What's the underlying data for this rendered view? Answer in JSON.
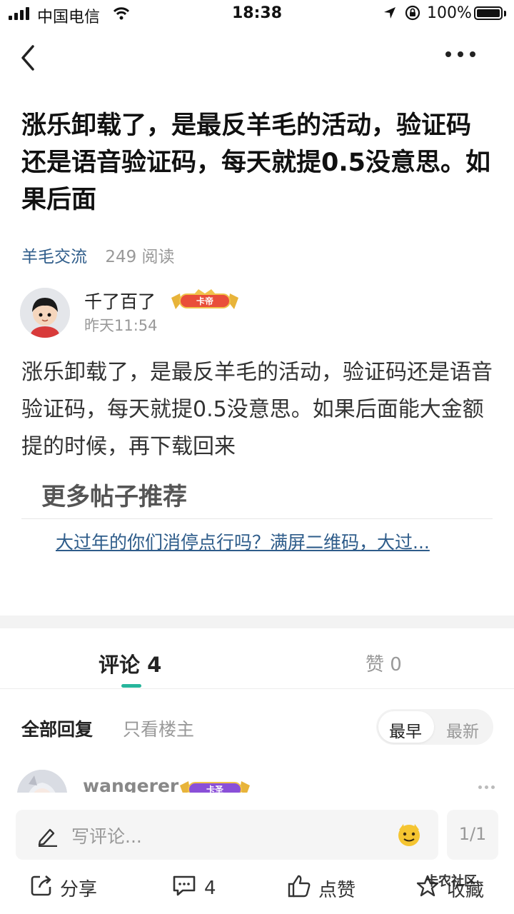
{
  "status_bar": {
    "carrier": "中国电信",
    "time": "18:38",
    "battery": "100%"
  },
  "post": {
    "title": "涨乐卸载了，是最反羊毛的活动，验证码还是语音验证码，每天就提0.5没意思。如果后面",
    "tag": "羊毛交流",
    "reads": "249 阅读",
    "author": "千了百了",
    "author_badge": "卡帝",
    "time": "昨天11:54",
    "body": "涨乐卸载了，是最反羊毛的活动，验证码还是语音验证码，每天就提0.5没意思。如果后面能大金额提的时候，再下载回来"
  },
  "recommend": {
    "heading": "更多帖子推荐",
    "link": "大过年的你们消停点行吗？满屏二维码，大过..."
  },
  "tabs": {
    "comments": "评论 4",
    "likes": "赞 0"
  },
  "filter": {
    "all": "全部回复",
    "op_only": "只看楼主",
    "earliest": "最早",
    "latest": "最新"
  },
  "comment": {
    "name": "wangerer",
    "badge": "卡圣"
  },
  "bottom": {
    "input_placeholder": "写评论...",
    "page": "1/1",
    "share": "分享",
    "comment_count": "4",
    "like": "点赞",
    "favorite": "收藏",
    "watermark": "卡农社区"
  },
  "colors": {
    "accent": "#27b59b",
    "link": "#2e5c8a"
  }
}
